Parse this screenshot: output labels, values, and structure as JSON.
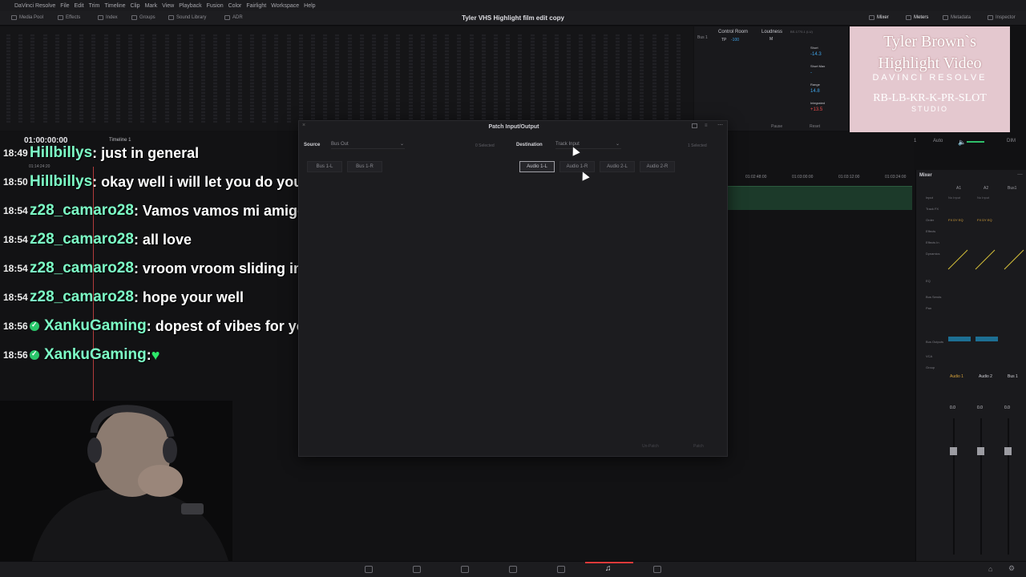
{
  "app": {
    "name": "DaVinci Resolve",
    "project_title": "Tyler VHS Highlight film edit copy"
  },
  "menu": [
    "File",
    "Edit",
    "Trim",
    "Timeline",
    "Clip",
    "Mark",
    "View",
    "Playback",
    "Fusion",
    "Color",
    "Fairlight",
    "Workspace",
    "Help"
  ],
  "toolbar": {
    "left": [
      "Media Pool",
      "Effects",
      "Index",
      "Groups",
      "Sound Library",
      "ADR"
    ],
    "right": [
      "Mixer",
      "Meters",
      "Metadata",
      "Inspector"
    ]
  },
  "control_room": {
    "label": "Control Room",
    "bus": "Bus 1",
    "tp": "TP",
    "tp_value": "-100",
    "m": "M",
    "loudness_label": "Loudness",
    "loudness_std": "BS.1770-1 (LU)",
    "short_label": "Short",
    "short_value": "-14.3",
    "shortmax_label": "Short Max",
    "shortmax_value": "-",
    "range_label": "Range",
    "range_value": "14.8",
    "integrated_label": "Integrated",
    "integrated_value": "+13.5",
    "pause": "Pause",
    "reset": "Reset"
  },
  "preview": {
    "line1": "Tyler Brown`s",
    "line2": "Highlight Video",
    "line3": "DAVINCI RESOLVE",
    "line4": "RB-LB-KR-K-PR-SLOT",
    "line5": "STUDIO",
    "bus": "Bus 1",
    "auto": "Auto",
    "dim": "DIM"
  },
  "timeline": {
    "timecode": "01:00:00:00",
    "name": "Timeline 1",
    "sub_timecode": "01:14:24:20",
    "ruler": [
      "01:02:48:00",
      "01:03:00:00",
      "01:03:12:00",
      "01:03:24:00"
    ]
  },
  "chat": [
    {
      "time": "18:49",
      "user": "Hillbillys",
      "msg": " : just in general",
      "badge": false
    },
    {
      "time": "18:50",
      "user": "Hillbillys",
      "msg": " : okay well i will let you do your thing , see your chair later",
      "badge": false
    },
    {
      "time": "18:54",
      "user": "z28_camaro28",
      "msg": " : Vamos vamos mi amigo",
      "badge": false
    },
    {
      "time": "18:54",
      "user": "z28_camaro28",
      "msg": " : all love",
      "badge": false
    },
    {
      "time": "18:54",
      "user": "z28_camaro28",
      "msg": " : vroom vroom sliding in to show some love",
      "badge": false
    },
    {
      "time": "18:54",
      "user": "z28_camaro28",
      "msg": " : hope your well",
      "badge": false
    },
    {
      "time": "18:56",
      "user": "XankuGaming",
      "msg": " : dopest of vibes for you my friend",
      "badge": true
    },
    {
      "time": "18:56",
      "user": "XankuGaming",
      "msg": " : ",
      "badge": true,
      "heart": "♥"
    }
  ],
  "patch": {
    "title": "Patch Input/Output",
    "source_label": "Source",
    "source_value": "Bus Out",
    "source_selected": "0 Selected",
    "dest_label": "Destination",
    "dest_value": "Track Input",
    "dest_selected": "1 Selected",
    "source_buttons": [
      "Bus 1-L",
      "Bus 1-R"
    ],
    "dest_buttons": [
      "Audio 1-L",
      "Audio 1-R",
      "Audio 2-L",
      "Audio 2-R"
    ],
    "unpatch": "Un-Patch",
    "patch": "Patch"
  },
  "mixer": {
    "title": "Mixer",
    "columns": [
      "A1",
      "A2",
      "Bus1"
    ],
    "rows": [
      "Input",
      "Track FX",
      "Order",
      "Effects",
      "Effects In",
      "Dynamics",
      "EQ",
      "Bus Sends",
      "Pan",
      "Bus Outputs",
      "VCA",
      "Group"
    ],
    "input_values": [
      "No Input",
      "No Input"
    ],
    "order_values": [
      "FX DY EQ",
      "FX DY EQ"
    ],
    "strips": [
      "Audio 1",
      "Audio 2",
      "Bus 1"
    ],
    "fader_values": [
      "0.0",
      "0.0",
      "0.0"
    ]
  }
}
